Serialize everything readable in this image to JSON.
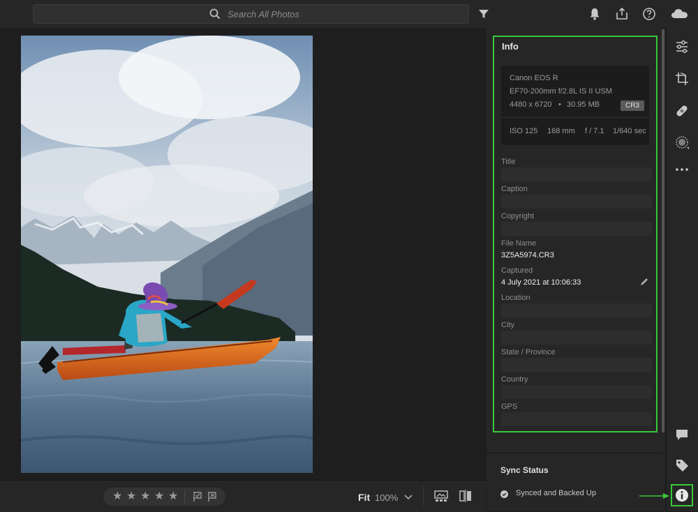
{
  "search": {
    "placeholder": "Search All Photos"
  },
  "bottombar": {
    "fit_label": "Fit",
    "zoom_label": "100%"
  },
  "rating": {
    "stars": 5,
    "value": 0
  },
  "info": {
    "title": "Info",
    "camera": {
      "model": "Canon EOS R",
      "lens": "EF70-200mm f/2.8L IS II USM",
      "dimensions": "4480 x 6720",
      "separator": "•",
      "size": "30.95 MB",
      "format": "CR3",
      "iso": "ISO 125",
      "focal": "168 mm",
      "aperture": "f / 7.1",
      "shutter": "1/640 sec"
    },
    "fields": {
      "title": {
        "label": "Title",
        "value": ""
      },
      "caption": {
        "label": "Caption",
        "value": ""
      },
      "copyright": {
        "label": "Copyright",
        "value": ""
      },
      "file_name": {
        "label": "File Name",
        "value": "3Z5A5974.CR3"
      },
      "captured": {
        "label": "Captured",
        "value": "4 July 2021 at 10:06:33"
      },
      "location": {
        "label": "Location",
        "value": ""
      },
      "city": {
        "label": "City",
        "value": ""
      },
      "state": {
        "label": "State / Province",
        "value": ""
      },
      "country": {
        "label": "Country",
        "value": ""
      },
      "gps": {
        "label": "GPS",
        "value": ""
      }
    }
  },
  "sync": {
    "title": "Sync Status",
    "status": "Synced and Backed Up"
  },
  "colors": {
    "accent_highlight": "#39c93b",
    "panel_bg": "#262626",
    "app_bg": "#1e1e1e"
  }
}
